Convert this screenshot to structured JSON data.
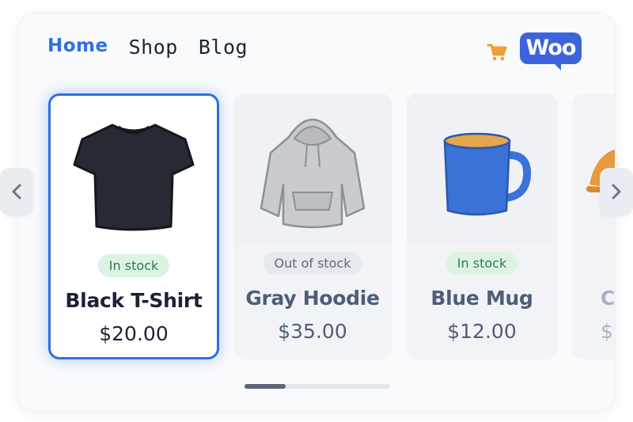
{
  "nav": {
    "items": [
      {
        "label": "Home",
        "active": true
      },
      {
        "label": "Shop",
        "active": false
      },
      {
        "label": "Blog",
        "active": false
      }
    ]
  },
  "header": {
    "cart_icon": "cart-icon",
    "logo_text": "Woo",
    "accent_color": "#2f6fe4",
    "cart_color": "#f0a030"
  },
  "carousel": {
    "products": [
      {
        "name": "Black T-Shirt",
        "price": "$20.00",
        "stock": "In stock",
        "image": "t-shirt-icon",
        "selected": true
      },
      {
        "name": "Gray Hoodie",
        "price": "$35.00",
        "stock": "Out of stock",
        "image": "hoodie-icon",
        "selected": false
      },
      {
        "name": "Blue Mug",
        "price": "$12.00",
        "stock": "In stock",
        "image": "mug-icon",
        "selected": false
      },
      {
        "name": "C",
        "price": "$",
        "stock": "",
        "image": "cap-icon",
        "selected": false
      }
    ],
    "prev_icon": "chevron-left-icon",
    "next_icon": "chevron-right-icon",
    "scroll_progress": 0.28
  }
}
